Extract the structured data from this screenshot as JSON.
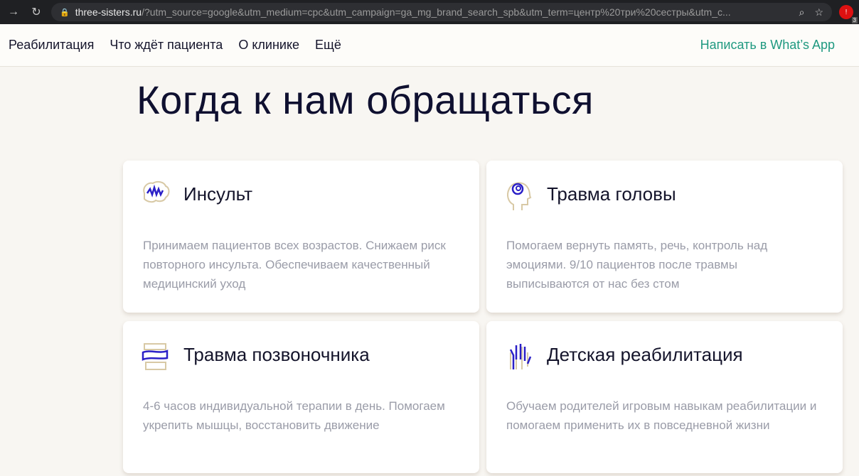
{
  "browser": {
    "url_host": "three-sisters.ru",
    "url_rest": "/?utm_source=google&utm_medium=cpc&utm_campaign=ga_mg_brand_search_spb&utm_term=центр%20три%20сестры&utm_c...",
    "ext_badge": "3"
  },
  "nav": {
    "items": [
      "Реабилитация",
      "Что ждёт пациента",
      "О клинике",
      "Ещё"
    ],
    "whatsapp": "Написать в What’s App"
  },
  "title": "Когда к нам обращаться",
  "cards": [
    {
      "title": "Инсульт",
      "text": "Принимаем пациентов всех возрастов. Снижаем риск повторного инсульта. Обеспечиваем качественный медицинский уход",
      "icon": "brain-icon"
    },
    {
      "title": "Травма головы",
      "text": "Помогаем вернуть память, речь, контроль над эмоциями. 9/10 пациентов после травмы выписываются от нас без стом",
      "icon": "head-icon"
    },
    {
      "title": "Травма позвоночника",
      "text": "4-6 часов индивидуальной терапии в день. Помогаем укрепить мышцы, восстановить движение",
      "icon": "spine-icon"
    },
    {
      "title": "Детская реабилитация",
      "text": "Обучаем родителей игровым навыкам реабилитации и помогаем применить их в повседневной жизни",
      "icon": "hand-icon"
    }
  ]
}
